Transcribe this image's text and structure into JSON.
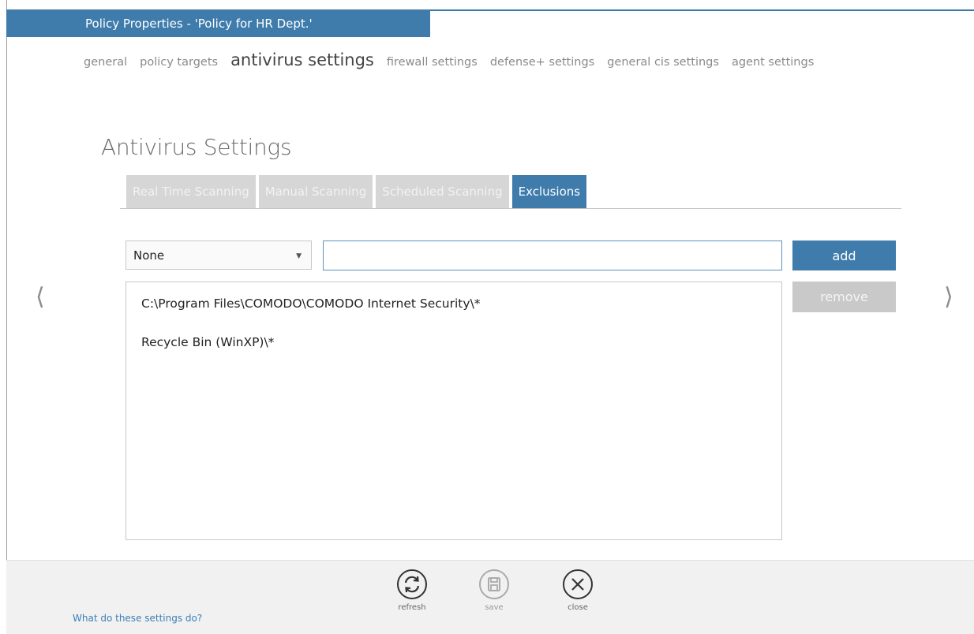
{
  "window": {
    "title": "Policy Properties - 'Policy for HR Dept.'"
  },
  "nav": {
    "items": [
      {
        "label": "general"
      },
      {
        "label": "policy targets"
      },
      {
        "label": "antivirus settings"
      },
      {
        "label": "firewall settings"
      },
      {
        "label": "defense+ settings"
      },
      {
        "label": "general cis settings"
      },
      {
        "label": "agent settings"
      }
    ],
    "active_index": 2
  },
  "page": {
    "title": "Antivirus Settings"
  },
  "tabs": [
    {
      "label": "Real Time Scanning"
    },
    {
      "label": "Manual Scanning"
    },
    {
      "label": "Scheduled Scanning"
    },
    {
      "label": "Exclusions"
    }
  ],
  "active_tab": "Exclusions",
  "exclusions": {
    "type_select": {
      "value": "None"
    },
    "path_input": {
      "value": "",
      "placeholder": ""
    },
    "add_label": "add",
    "remove_label": "remove",
    "items": [
      {
        "path": "C:\\Program Files\\COMODO\\COMODO Internet Security\\*"
      },
      {
        "path": "Recycle Bin (WinXP)\\*"
      }
    ]
  },
  "pager": {
    "prev_icon": "chevron-left-icon",
    "next_icon": "chevron-right-icon"
  },
  "footer": {
    "help_link": "What do these settings do?",
    "refresh_label": "refresh",
    "save_label": "save",
    "close_label": "close"
  },
  "colors": {
    "accent": "#3f7cac",
    "tab_inactive": "#d6d6d6",
    "remove_disabled": "#c9c9c9",
    "link": "#3e7fb6"
  }
}
